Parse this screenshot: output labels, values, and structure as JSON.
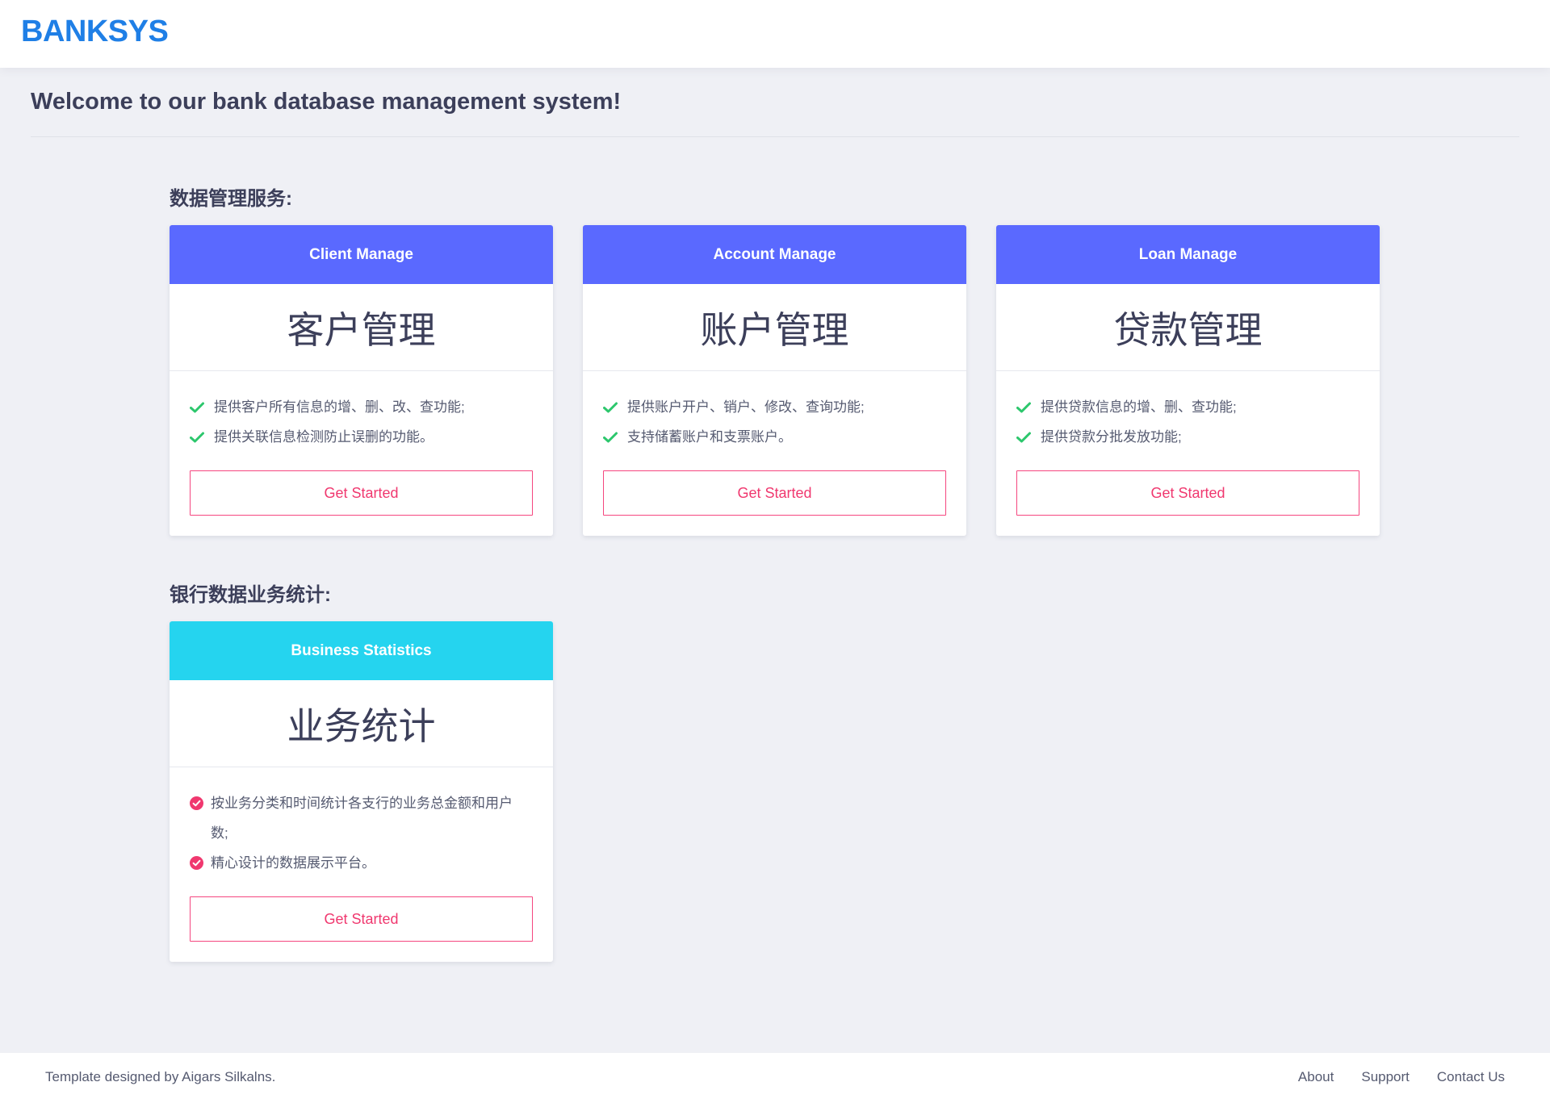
{
  "header": {
    "brand": "BANKSYS"
  },
  "welcome": "Welcome to our bank database management system!",
  "sections": {
    "data_services": "数据管理服务:",
    "statistics": "银行数据业务统计:"
  },
  "cards": [
    {
      "header": "Client Manage",
      "title": "客户管理",
      "features": [
        "提供客户所有信息的增、删、改、查功能;",
        "提供关联信息检测防止误删的功能。"
      ],
      "button": "Get Started"
    },
    {
      "header": "Account Manage",
      "title": "账户管理",
      "features": [
        "提供账户开户、销户、修改、查询功能;",
        "支持储蓄账户和支票账户。"
      ],
      "button": "Get Started"
    },
    {
      "header": "Loan Manage",
      "title": "贷款管理",
      "features": [
        "提供贷款信息的增、删、查功能;",
        "提供贷款分批发放功能;"
      ],
      "button": "Get Started"
    },
    {
      "header": "Business Statistics",
      "title": "业务统计",
      "features": [
        "按业务分类和时间统计各支行的业务总金额和用户数;",
        "精心设计的数据展示平台。"
      ],
      "button": "Get Started"
    }
  ],
  "footer": {
    "credit": "Template designed by Aigars Silkalns.",
    "links": [
      "About",
      "Support",
      "Contact Us"
    ]
  },
  "colors": {
    "brand": "#1f7fe6",
    "card_header_primary": "#5a69ff",
    "card_header_statistics": "#25d4ef",
    "check_icon": "#2dc76d",
    "accent": "#f0386f"
  },
  "icons": {
    "service_feature": "check-icon",
    "statistics_feature": "check-circle-icon"
  }
}
